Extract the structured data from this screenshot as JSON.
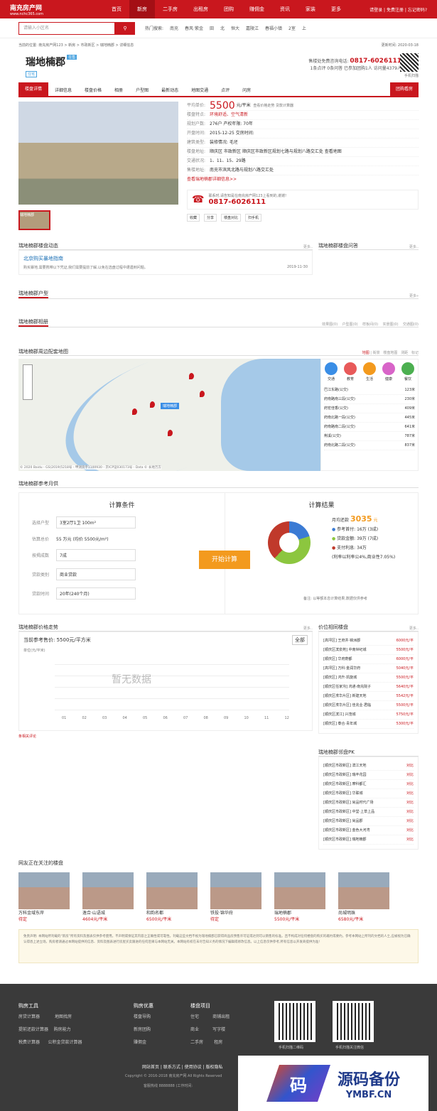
{
  "nav": {
    "logo": "南充房产网",
    "logo_sub": "www.nchc365.com",
    "items": [
      "首页",
      "新房",
      "二手房",
      "出租房",
      "团购",
      "赚佣金",
      "资讯",
      "家装",
      "更多"
    ],
    "links": "请登录 | 免费注册 | 忘记密码?"
  },
  "search": {
    "placeholder": "请输入小区名",
    "label": "热门搜索:",
    "hot": [
      "南充",
      "春风·紫金",
      "田",
      "北",
      "恒大",
      "嘉陵江",
      "春福小镇",
      "2室",
      "上"
    ]
  },
  "crumb": {
    "path": "当前的位置: 南充房产网123 > 新房 > 市政新区 > 瑞地楠郡 > 详细信息",
    "update": "更新时间: 2020-03-18"
  },
  "title": {
    "name": "瑞地楠郡",
    "status": "在售",
    "type": "住宅",
    "phone_label": "售楼处免费咨询电话:",
    "phone": "0817-6026111",
    "sub": "1条点评 0条问答 已参加团购1人 访问量4379人",
    "qr_caption": "手机扫描"
  },
  "tabs": [
    "楼盘详情",
    "详细信息",
    "楼盘价格",
    "相册",
    "户型图",
    "最新动态",
    "地图交通",
    "点评",
    "问房"
  ],
  "group_btn": "团购看房",
  "props": {
    "price_label": "平均单价:",
    "price": "5500",
    "unit": "元/平米",
    "price_links": "查看价格走势   贷款计算器",
    "rows": [
      [
        "楼盘特点:",
        "环境舒适、空气清新"
      ],
      [
        "规划户数:",
        "276户   产权年限: 70年"
      ],
      [
        "开盘时间:",
        "2015-12-25   交房时间:"
      ],
      [
        "建筑类型:",
        "   装修情况: 毛坯"
      ],
      [
        "楼盘地址:",
        "顺庆区 市政新区 顺庆区市政新区规划七路与规划八路交汇处 查看地图"
      ],
      [
        "交通状况:",
        "1、11、15、29路"
      ],
      [
        "售楼地址:",
        "南充市滨风北路与规划八路交汇处"
      ]
    ],
    "more": "查看瑞地楠郡详细信息>>",
    "call_note": "联系时,请告知是在南充房产网123上看到的,谢谢!",
    "call_phone": "0817-6026111",
    "actions": [
      "收藏",
      "分享",
      "楼盘对比",
      "扫手机"
    ]
  },
  "photo": {
    "caption": "瑞地楠郡"
  },
  "news": {
    "title": "瑞地楠郡楼盘动态",
    "more": "更多..",
    "item": "北京购买暴地指南",
    "desc": "购买暴地,需要携带以下凭证,我们需要提前了解,以免在选盘过程中遭遇到问题。",
    "date": "2019-11-30",
    "qa_title": "瑞地楠郡楼盘问答",
    "qa_more": "更多.."
  },
  "hx": {
    "title": "瑞地楠郡户型",
    "more": "更多»"
  },
  "album": {
    "title": "瑞地楠郡相册",
    "cats": [
      "效果图(0)",
      "户型图(0)",
      "样板间(0)",
      "实景图(0)",
      "交通图(0)"
    ]
  },
  "map": {
    "title": "瑞地楠郡周边配套地图",
    "modes": [
      "地图",
      "街景",
      "楼盘地图",
      "测距",
      "标记"
    ],
    "cats": [
      "交通",
      "教育",
      "生活",
      "健康",
      "餐饮"
    ],
    "poi": [
      [
        "巴江东路(公交)",
        "123米"
      ],
      [
        "府南路南三段(公交)",
        "230米"
      ],
      [
        "府宏佳香(公交)",
        "409米"
      ],
      [
        "府南北路一段(公交)",
        "445米"
      ],
      [
        "府南路南二段(公交)",
        "641米"
      ],
      [
        "荆溪(公交)",
        "787米"
      ],
      [
        "府南北路二段(公交)",
        "837米"
      ]
    ],
    "label": "瑞地楠郡",
    "copy": "© 2020 Baidu - GS(2019)5218号 - 甲测资字1100930 - 京ICP证030173号 - Data © 长地万方"
  },
  "calc": {
    "title": "瑞地楠郡参考月供",
    "cond": "计算条件",
    "rows": [
      [
        "选择户型",
        "3室2厅1卫 100m²"
      ],
      [
        "估算总价",
        "55 万元 (均价 5500元/m²)"
      ],
      [
        "按揭成数",
        "7成"
      ],
      [
        "贷款类别",
        "商业贷款"
      ],
      [
        "贷款时间",
        "20年(240个月)"
      ]
    ],
    "btn": "开始计算",
    "result": "计算结果",
    "monthly_label": "月均还款",
    "monthly": "3035",
    "monthly_unit": "元",
    "legend": [
      "参考首付: 16万 (3成)",
      "贷款金额: 39万 (7成)",
      "支付利息: 34万",
      "(利率以利率公4%,商业性7.05%)"
    ],
    "note": "备注: 以等额本息计算结果,数据仅供参考"
  },
  "trend": {
    "title": "瑞地楠郡价格走势",
    "more": "更多..",
    "cur": "当前参考售价: 5500元/平方米",
    "all": "全部",
    "unit": "单位(元/平米)",
    "empty": "暂无数据",
    "x": [
      "01",
      "02",
      "03",
      "04",
      "05",
      "06",
      "07",
      "08",
      "09",
      "10",
      "11",
      "12"
    ]
  },
  "similar": {
    "title": "价位相同楼盘",
    "more": "更多..",
    "items": [
      [
        "[高坪区] 王府井·锦洲郡",
        "6000元/平"
      ],
      [
        "[顺庆区滨泉苑] 中南世纪城",
        "5500元/平"
      ],
      [
        "[顺庆区] 华府蔚都",
        "6000元/平"
      ],
      [
        "[高坪区] 万科·金润华府",
        "5040元/平"
      ],
      [
        "[顺庆区] 鸿升·凯旋城",
        "5500元/平"
      ],
      [
        "[顺庆区任家沟] 鸿通·南充院子",
        "5640元/平"
      ],
      [
        "[顺庆区潆华片区] 新建天地",
        "5542元/平"
      ],
      [
        "[顺庆区潆华片区] 佳兆业·君临",
        "5500元/平"
      ],
      [
        "[顺庆区滨江] 兴茂城",
        "5750元/平"
      ],
      [
        "[顺庆区] 泰合·青年城",
        "5300元/平"
      ]
    ]
  },
  "comment": "条相关评论",
  "pk": {
    "title": "瑞地楠郡邻盘PK",
    "btn": "对比",
    "items": [
      "[顺庆区市政新区] 滨江天地",
      "[顺庆区市政新区] 瑞丰花园",
      "[顺庆区市政新区] 摩科都汇",
      "[顺庆区市政新区] 华联城",
      "[顺庆区市政新区] 尚品时代广场",
      "[顺庆区市政新区] 中堂·上草上品",
      "[顺庆区市政新区] 尚品郡",
      "[顺庆区市政新区] 金色大河湾",
      "[顺庆区市政新区] 瑞地楠郡"
    ]
  },
  "feat": {
    "title": "网友正在关注的楼盘",
    "items": [
      [
        "万科金域东岸",
        "待定"
      ],
      [
        "逸合·山语城",
        "4604元/平米"
      ],
      [
        "和韵名都",
        "6500元/平米"
      ],
      [
        "铁投·锦华府",
        "待定"
      ],
      [
        "瑞地楠郡",
        "5500元/平米"
      ],
      [
        "尚城明珠",
        "6580元/平米"
      ]
    ]
  },
  "disclaimer": "免责声明: 本网站所刊载的“新房”所有资料及图表仅供参考使用。不声明或保证其内容之正确性或可靠性。刊载这些文档不视为瑞地楠郡已获得商品房预售许可证或达到可以销售的标准。且不构成对任何楼盘的购买的邀约或要约。参考本网站上所刊的文档的人士,应被视为已确认得悉上述立场。购房者请通过本网站提供的信息、资料及图表进行房屋买卖跟进的任何后果与本网站无关。本网站有权在未尽告知义务的情况下编辑或修改信息。以上信息仅供参考,所有信息以开发商提供为准!",
  "footer": {
    "cols": [
      {
        "h": "购房工具",
        "items": [
          "房贷计算器",
          "地图找房",
          "提前还款计算器",
          "购房能力",
          "税费计算器",
          "公积金贷款计算器"
        ]
      },
      {
        "h": "购房优惠",
        "items": [
          "楼盘导购",
          "新房团购",
          "赚佣金"
        ]
      },
      {
        "h": "楼盘项目",
        "items": [
          "住宅",
          "商铺出租",
          "商业",
          "写字楼",
          "二手房",
          "租房"
        ]
      }
    ],
    "qr1": "手机扫描二维码",
    "qr2": "手机扫描关注微信",
    "links": "网站首页 | 联系方式 | 使用协议 | 版权隐私",
    "copy": "Copyright © 2016-2018 南充房产网 All Rights Reserved",
    "tel": "客服热线 8888888 (工作时间:"
  },
  "brand": {
    "cn": "源码备份",
    "en": "YMBF.CN",
    "mark": "码"
  }
}
